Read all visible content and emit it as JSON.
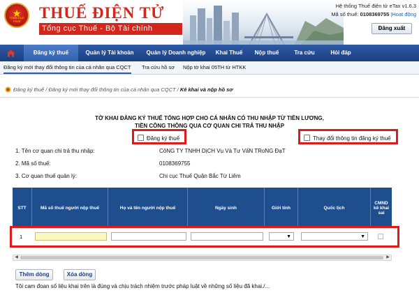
{
  "header": {
    "brand_title": "THUẾ ĐIỆN TỬ",
    "brand_subtitle": "Tổng cục Thuế - Bộ Tài chính",
    "emblem_text": "TỔNG CỤC THUẾ",
    "system_name": "Hệ thống Thuế điện tử eTax v1.6.3",
    "tax_code_label": "Mã số thuế:",
    "tax_code": "0108369755",
    "separator": "|",
    "activity_link": "Hoạt động",
    "logout": "Đăng xuất"
  },
  "nav": {
    "items": [
      {
        "label": "Đăng ký thuế",
        "active": true
      },
      {
        "label": "Quản lý Tài khoản",
        "active": false
      },
      {
        "label": "Quản lý Doanh nghiệp",
        "active": false
      },
      {
        "label": "Khai Thuế",
        "active": false
      },
      {
        "label": "Nộp thuế",
        "active": false
      },
      {
        "label": "Tra cứu",
        "active": false
      },
      {
        "label": "Hỏi đáp",
        "active": false
      }
    ]
  },
  "subnav": {
    "items": [
      {
        "label": "Đăng ký mới thay đổi thông tin của cá nhân qua CQCT",
        "active": true
      },
      {
        "label": "Tra cứu hồ sơ",
        "active": false
      },
      {
        "label": "Nộp tờ khai 05TH từ HTKK",
        "active": false
      }
    ]
  },
  "breadcrumb": {
    "path": "Đăng ký thuế / Đăng ký mới thay đổi thông tin của cá nhân qua CQCT /",
    "current": "Kê khai và nộp hồ sơ"
  },
  "form": {
    "title_line1": "TỜ KHAI ĐĂNG KÝ THUẾ TỔNG HỢP CHO CÁ NHÂN CÓ THU NHẬP TỪ TIỀN LƯƠNG,",
    "title_line2": "TIỀN CÔNG THÔNG QUA CƠ QUAN CHI TRẢ THU NHẬP",
    "option_register": "Đăng ký thuế",
    "option_change": "Thay đổi thông tin đăng ký thuế",
    "info": [
      {
        "label": "1. Tên cơ quan chi trả thu nhập:",
        "value": "CôNG TY TNHH DịCH Vụ Và Tư VấN TRoNG ĐạT"
      },
      {
        "label": "2. Mã số thuế:",
        "value": "0108369755"
      },
      {
        "label": "3. Cơ quan thuế quản lý:",
        "value": "Chi cục Thuế Quận Bắc Từ Liêm"
      }
    ]
  },
  "table": {
    "columns": [
      "STT",
      "Mã số thuế người nộp thuế",
      "Họ và tên người nộp thuế",
      "Ngày sinh",
      "Giới tính",
      "Quốc tịch",
      "CMND kê khai sai"
    ],
    "rows": [
      {
        "stt": "1",
        "ma_so_thue": "",
        "ho_ten": "",
        "ngay_sinh": "",
        "gioi_tinh": "",
        "quoc_tich": "",
        "cmnd_ke_khai_sai": false
      }
    ]
  },
  "actions": {
    "add_row": "Thêm dòng",
    "delete_row": "Xóa dòng"
  },
  "commitment": "Tôi cam đoan số liệu khai trên là đúng và chịu trách nhiệm trước pháp luật về những số liệu đã khai./...",
  "colors": {
    "brand_red": "#d4261a",
    "nav_blue": "#2d5aa6",
    "table_header": "#1f4e8f",
    "highlight_red": "#e01a1a",
    "input_yellow": "#fdf7c1"
  }
}
